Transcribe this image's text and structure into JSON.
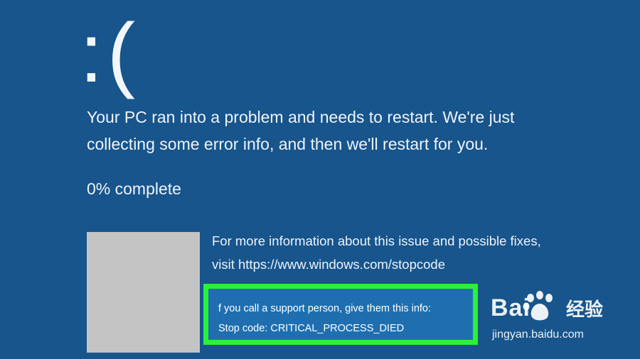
{
  "screen": {
    "background_color": "#17558c",
    "sad_face": ":(",
    "message": "Your PC ran into a problem and needs to restart. We're just collecting some error info, and then we'll restart for you.",
    "progress_text": "0% complete",
    "progress_percent": 0,
    "more_info": "For more information about this issue and possible fixes, visit https://www.windows.com/stopcode",
    "support_intro": "f you call a support person, give them this info:",
    "stop_code": "Stop code: CRITICAL_PROCESS_DIED",
    "highlight_color": "#29f23a"
  },
  "watermark": {
    "brand": "Bai",
    "brand_suffix": "经验",
    "url": "jingyan.baidu.com",
    "icon": "baidu-paw-icon"
  }
}
